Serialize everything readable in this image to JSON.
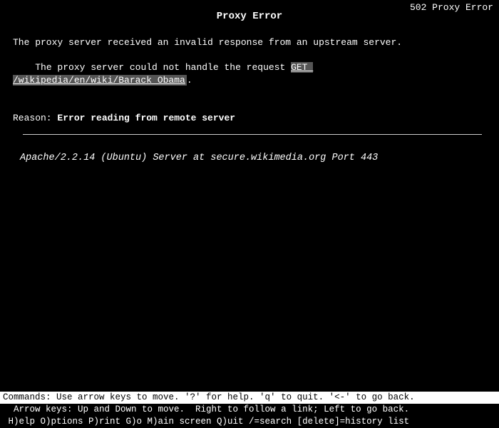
{
  "topright": "502 Proxy Error",
  "page": {
    "title": "Proxy Error",
    "line1": "The proxy server received an invalid response from an upstream server.",
    "line2_prefix": "The proxy server could not handle the request ",
    "line2_link": "GET /wikipedia/en/wiki/Barack_Obama",
    "line2_suffix": ".",
    "reason_label": "Reason: ",
    "reason_value": "Error reading from remote server",
    "server_line": "Apache/2.2.14 (Ubuntu) Server at secure.wikimedia.org Port 443"
  },
  "status": {
    "line1": "Commands: Use arrow keys to move. '?' for help. 'q' to quit. '<-' to go back.",
    "line2": "  Arrow keys: Up and Down to move.  Right to follow a link; Left to go back.",
    "line3": " H)elp O)ptions P)rint G)o M)ain screen Q)uit /=search [delete]=history list"
  }
}
